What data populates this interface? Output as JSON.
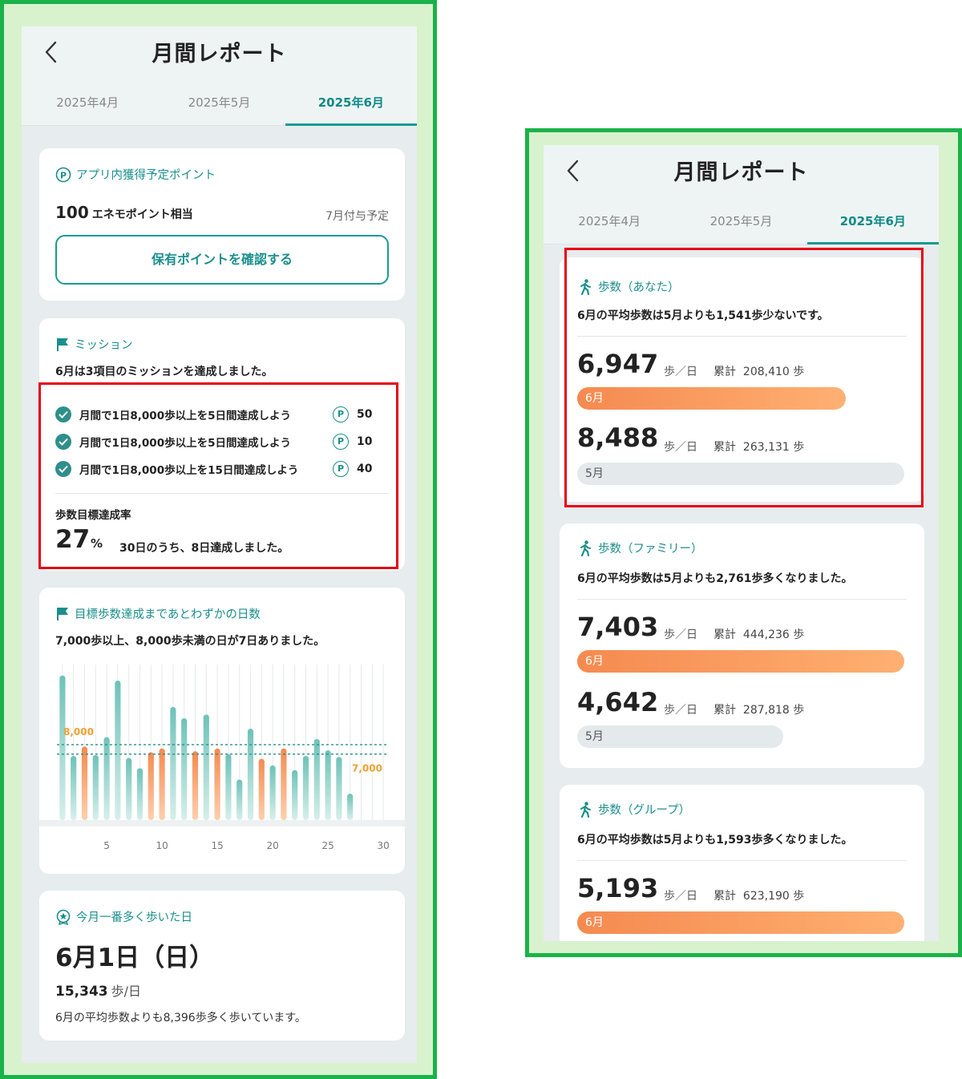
{
  "header": {
    "title": "月間レポート",
    "tabs": [
      "2025年4月",
      "2025年5月",
      "2025年6月"
    ],
    "active_tab": 2
  },
  "points_card": {
    "title": "アプリ内獲得予定ポイント",
    "amount": "100",
    "amount_unit": "エネモポイント相当",
    "note": "7月付与予定",
    "button_label": "保有ポイントを確認する"
  },
  "mission_card": {
    "title": "ミッション",
    "summary": "6月は3項目のミッションを達成しました。",
    "items": [
      {
        "label": "月間で1日8,000歩以上を5日間達成しよう",
        "points": "50"
      },
      {
        "label": "月間で1日8,000歩以上を5日間達成しよう",
        "points": "10"
      },
      {
        "label": "月間で1日8,000歩以上を15日間達成しよう",
        "points": "40"
      }
    ],
    "point_symbol": "P",
    "rate_label": "歩数目標達成率",
    "rate_value": "27",
    "rate_unit": "%",
    "rate_note": "30日のうち、8日達成しました。"
  },
  "near_goal_card": {
    "title": "目標歩数達成まであとわずかの日数",
    "summary": "7,000歩以上、8,000歩未満の日が7日ありました。",
    "line_label_high": "8,000",
    "line_label_low": "7,000"
  },
  "chart_data": {
    "type": "bar",
    "title": "",
    "x": [
      1,
      2,
      3,
      4,
      5,
      6,
      7,
      8,
      9,
      10,
      11,
      12,
      13,
      14,
      15,
      16,
      17,
      18,
      19,
      20,
      21,
      22,
      23,
      24,
      25,
      26,
      27,
      28,
      29,
      30
    ],
    "values": [
      15343,
      6800,
      7800,
      6900,
      8800,
      14800,
      6600,
      5500,
      7200,
      7600,
      12000,
      10800,
      7300,
      11200,
      7600,
      7000,
      4300,
      9700,
      6500,
      5800,
      7600,
      5300,
      6800,
      8600,
      7400,
      6700,
      2800,
      0,
      0,
      0
    ],
    "highlight": [
      false,
      false,
      true,
      false,
      false,
      false,
      false,
      false,
      true,
      true,
      false,
      false,
      true,
      false,
      true,
      false,
      false,
      false,
      true,
      false,
      true,
      false,
      false,
      false,
      false,
      false,
      false,
      false,
      false,
      false
    ],
    "xticks": [
      "5",
      "10",
      "15",
      "20",
      "25",
      "30"
    ],
    "reference_lines": [
      8000,
      7000
    ],
    "ylim": [
      0,
      16500
    ],
    "colors": {
      "normal": "#7cc8c0",
      "highlight": "#f7955a"
    }
  },
  "best_day_card": {
    "title": "今月一番多く歩いた日",
    "date": "6月1日（日）",
    "steps": "15,343",
    "steps_unit": "歩/日",
    "note": "6月の平均歩数よりも8,396歩多く歩いています。"
  },
  "step_cards": [
    {
      "title": "歩数（あなた）",
      "summary": "6月の平均歩数は5月よりも1,541歩少ないです。",
      "current": {
        "value": "6,947",
        "unit": "歩／日",
        "total_label": "累計",
        "total": "208,410 歩",
        "bar_label": "6月",
        "ratio": 0.82
      },
      "previous": {
        "value": "8,488",
        "unit": "歩／日",
        "total_label": "累計",
        "total": "263,131 歩",
        "bar_label": "5月",
        "ratio": 1.0
      }
    },
    {
      "title": "歩数（ファミリー）",
      "summary": "6月の平均歩数は5月よりも2,761歩多くなりました。",
      "current": {
        "value": "7,403",
        "unit": "歩／日",
        "total_label": "累計",
        "total": "444,236 歩",
        "bar_label": "6月",
        "ratio": 1.0
      },
      "previous": {
        "value": "4,642",
        "unit": "歩／日",
        "total_label": "累計",
        "total": "287,818 歩",
        "bar_label": "5月",
        "ratio": 0.63
      }
    },
    {
      "title": "歩数（グループ）",
      "summary": "6月の平均歩数は5月よりも1,593歩多くなりました。",
      "current": {
        "value": "5,193",
        "unit": "歩／日",
        "total_label": "累計",
        "total": "623,190 歩",
        "bar_label": "6月",
        "ratio": 1.0
      }
    }
  ],
  "colors": {
    "accent": "#1a8f8c",
    "frame": "#1ab24a",
    "highlight_box": "#e60012"
  }
}
